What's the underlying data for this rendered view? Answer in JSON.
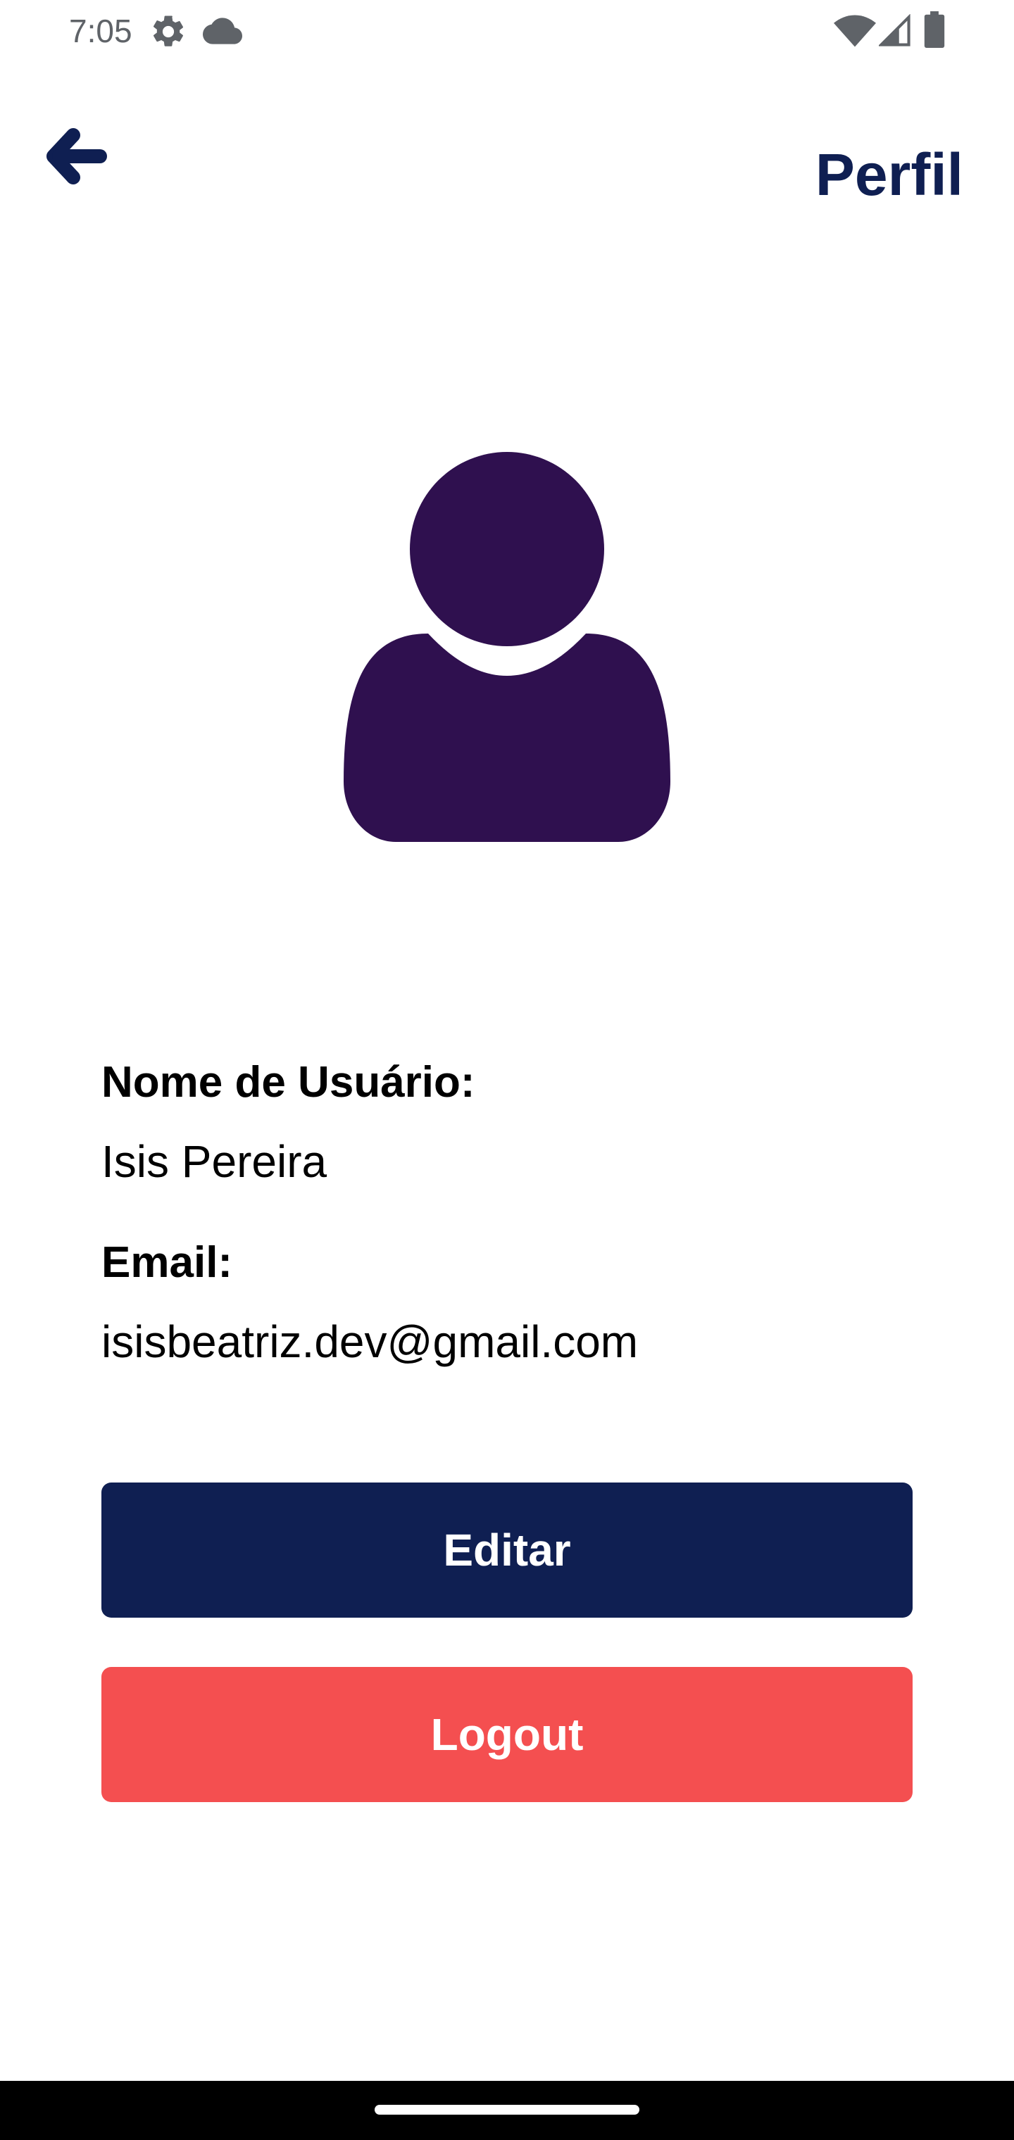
{
  "status_bar": {
    "time": "7:05",
    "icons": [
      "settings-gear-icon",
      "cloud-icon",
      "wifi-icon",
      "cell-signal-icon",
      "battery-icon"
    ]
  },
  "header": {
    "back_icon": "arrow-left-icon",
    "title": "Perfil"
  },
  "profile": {
    "avatar_icon": "user-silhouette-icon",
    "username_label": "Nome de Usuário:",
    "username_value": "Isis Pereira",
    "email_label": "Email:",
    "email_value": "isisbeatriz.dev@gmail.com"
  },
  "actions": {
    "edit_label": "Editar",
    "logout_label": "Logout"
  },
  "colors": {
    "primary": "#0f1f52",
    "avatar": "#2f104f",
    "danger": "#f44f50",
    "text": "#000000",
    "status_text": "#5f6368"
  },
  "nav_bar": {
    "home_indicator": "home-indicator"
  }
}
